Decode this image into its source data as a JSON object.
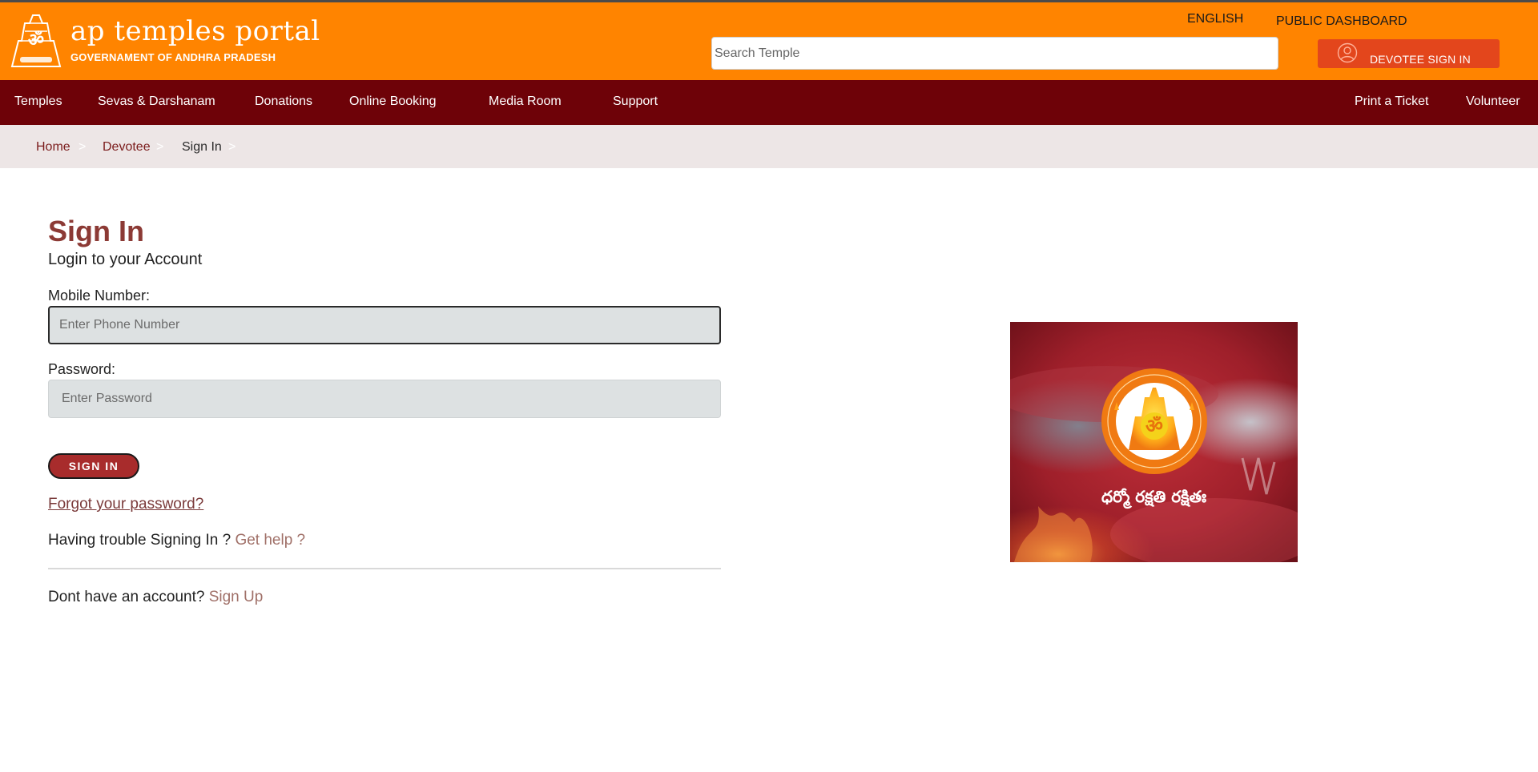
{
  "header": {
    "brand_title": "ap temples portal",
    "brand_subtitle": "GOVERNAMENT OF ANDHRA PRADESH",
    "language": "ENGLISH",
    "public_dashboard": "PUBLIC DASHBOARD",
    "search_placeholder": "Search Temple",
    "devotee_signin": "DEVOTEE SIGN IN",
    "colors": {
      "orange": "#ff8400",
      "signin_button": "#e3461c"
    }
  },
  "nav": {
    "items": [
      "Temples",
      "Sevas & Darshanam",
      "Donations",
      "Online Booking",
      "Media Room",
      "Support"
    ],
    "right_items": [
      "Print a Ticket",
      "Volunteer"
    ],
    "color": "#6e0208"
  },
  "breadcrumb": {
    "items": [
      "Home",
      "Devotee",
      "Sign In"
    ],
    "separator": ">"
  },
  "form": {
    "title": "Sign In",
    "subtitle": "Login to your Account",
    "mobile_label": "Mobile Number:",
    "mobile_placeholder": "Enter Phone Number",
    "password_label": "Password:",
    "password_placeholder": "Enter Password",
    "submit_label": "SIGN IN",
    "forgot_password": "Forgot your password?",
    "trouble_text": "Having trouble Signing In ?",
    "get_help": "Get help ?",
    "no_account_text": "Dont have an account?",
    "sign_up": "Sign Up"
  },
  "banner": {
    "motto": "ధర్మో రక్షతి రక్షితః",
    "emblem_icon": "om-temple-emblem-icon"
  }
}
